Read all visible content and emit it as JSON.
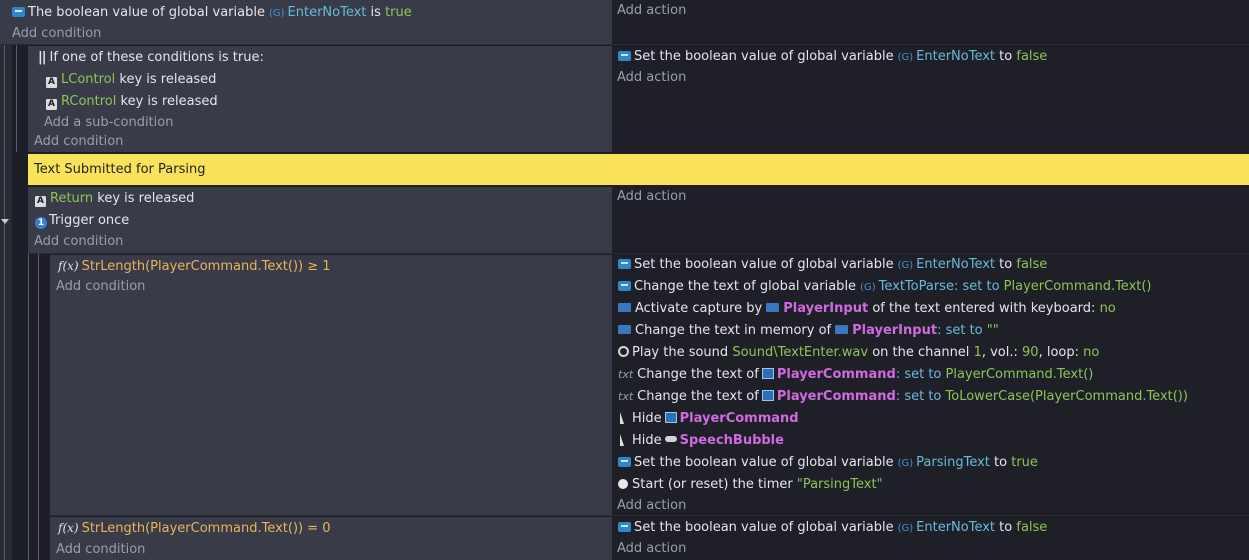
{
  "events": {
    "e1": {
      "condition": {
        "prefix": "The boolean value of global variable",
        "var": "EnterNoText",
        "is_word": "is",
        "value": "true"
      },
      "add_condition": "Add condition",
      "add_action": "Add action"
    },
    "e1sub": {
      "or_header": "If one of these conditions is true:",
      "sub1": {
        "key": "LControl",
        "suffix": "key is released"
      },
      "sub2": {
        "key": "RControl",
        "suffix": "key is released"
      },
      "add_sub_condition": "Add a sub-condition",
      "add_condition": "Add condition",
      "action1": {
        "prefix": "Set the boolean value of global variable",
        "var": "EnterNoText",
        "to_word": "to",
        "value": "false"
      },
      "add_action": "Add action"
    },
    "comment": "Text Submitted for Parsing",
    "e2": {
      "cond1": {
        "key": "Return",
        "suffix": "key is released"
      },
      "cond2": "Trigger once",
      "add_condition": "Add condition",
      "add_action": "Add action"
    },
    "e3": {
      "condition": {
        "expr": "StrLength(PlayerCommand.Text())",
        "op": "≥",
        "value": "1"
      },
      "add_condition": "Add condition",
      "actions": {
        "a1": {
          "prefix": "Set the boolean value of global variable",
          "var": "EnterNoText",
          "to_word": "to",
          "value": "false"
        },
        "a2": {
          "prefix": "Change the text of global variable",
          "var": "TextToParse",
          "mid": ": set to",
          "value": "PlayerCommand.Text()"
        },
        "a3": {
          "prefix": "Activate capture by",
          "obj": "PlayerInput",
          "mid": "of the text entered with keyboard:",
          "value": "no"
        },
        "a4": {
          "prefix": "Change the text in memory of",
          "obj": "PlayerInput",
          "mid": ": set to",
          "value": "\"\""
        },
        "a5": {
          "prefix": "Play the sound",
          "file": "Sound\\TextEnter.wav",
          "mid1": "on the channel",
          "channel": "1",
          "mid2": ", vol.:",
          "vol": "90",
          "mid3": ", loop:",
          "loop": "no"
        },
        "a6": {
          "prefix": "Change the text of",
          "obj": "PlayerCommand",
          "mid": ": set to",
          "value": "PlayerCommand.Text()"
        },
        "a7": {
          "prefix": "Change the text of",
          "obj": "PlayerCommand",
          "mid": ": set to",
          "value": "ToLowerCase(PlayerCommand.Text())"
        },
        "a8": {
          "prefix": "Hide",
          "obj": "PlayerCommand"
        },
        "a9": {
          "prefix": "Hide",
          "obj": "SpeechBubble"
        },
        "a10": {
          "prefix": "Set the boolean value of global variable",
          "var": "ParsingText",
          "to_word": "to",
          "value": "true"
        },
        "a11": {
          "prefix": "Start (or reset) the timer",
          "value": "\"ParsingText\""
        }
      },
      "add_action": "Add action"
    },
    "e4": {
      "condition": {
        "expr": "StrLength(PlayerCommand.Text())",
        "op": "=",
        "value": "0"
      },
      "add_condition": "Add condition",
      "action1": {
        "prefix": "Set the boolean value of global variable",
        "var": "EnterNoText",
        "to_word": "to",
        "value": "false"
      },
      "add_action": "Add action"
    }
  }
}
